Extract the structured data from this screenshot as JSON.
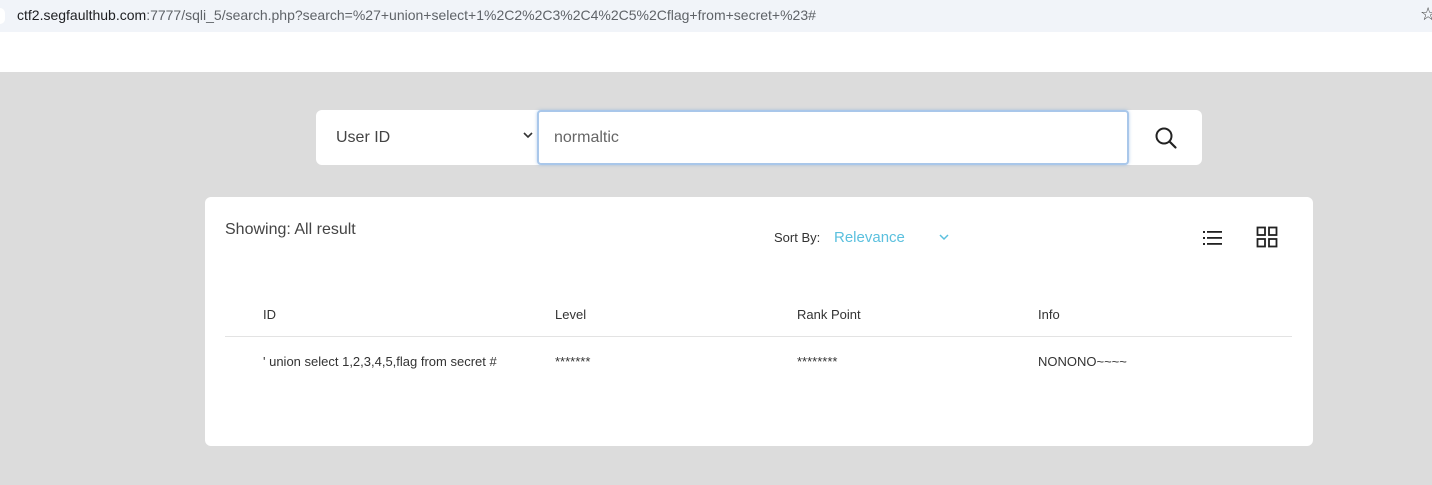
{
  "browser": {
    "url_host": "ctf2.segfaulthub.com",
    "url_path": ":7777/sqli_5/search.php?search=%27+union+select+1%2C2%2C3%2C4%2C5%2Cflag+from+secret+%23#",
    "bookmark_icon": "☆"
  },
  "search": {
    "select_value": "User ID",
    "input_value": "normaltic"
  },
  "results": {
    "showing_label": "Showing: All result",
    "sort_by_label": "Sort By:",
    "sort_value": "Relevance",
    "columns": [
      "ID",
      "Level",
      "Rank Point",
      "Info"
    ],
    "rows": [
      [
        "' union select 1,2,3,4,5,flag from secret #",
        "*******",
        "********",
        "NONONO~~~~"
      ]
    ]
  },
  "colors": {
    "accent": "#5bc0de",
    "page_background": "#dcdcdc",
    "input_focus_border": "#a9c7ea"
  }
}
